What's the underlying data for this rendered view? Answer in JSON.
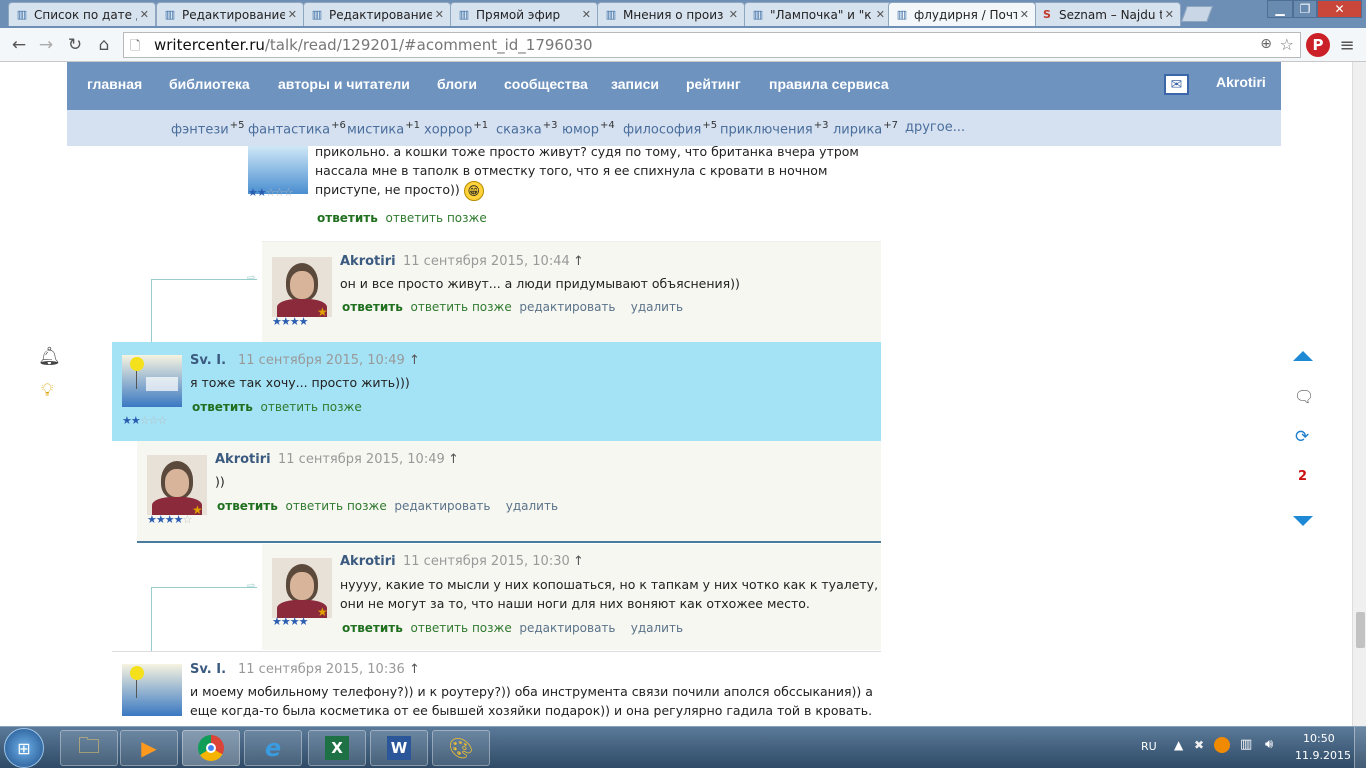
{
  "tabs": [
    {
      "title": "Список по дате д"
    },
    {
      "title": "Редактирование"
    },
    {
      "title": "Редактирование"
    },
    {
      "title": "Прямой эфир"
    },
    {
      "title": "Мнения о произ"
    },
    {
      "title": "\"Лампочка\" и \"к"
    },
    {
      "title": "флудирня / Почт"
    },
    {
      "title": "Seznam – Najdu t"
    }
  ],
  "address": {
    "host": "writercenter.ru",
    "path": "/talk/read/129201/#acomment_id_1796030"
  },
  "nav": {
    "items": [
      "главная",
      "библиотека",
      "авторы и читатели",
      "блоги",
      "сообщества",
      "записи",
      "рейтинг",
      "правила сервиса"
    ],
    "user": "Akrotiri"
  },
  "genres": [
    {
      "label": "фэнтези",
      "count": "+5"
    },
    {
      "label": "фантастика",
      "count": "+6"
    },
    {
      "label": "мистика",
      "count": "+1"
    },
    {
      "label": "хоррор",
      "count": "+1"
    },
    {
      "label": "сказка",
      "count": "+3"
    },
    {
      "label": "юмор",
      "count": "+4"
    },
    {
      "label": "философия",
      "count": "+5"
    },
    {
      "label": "приключения",
      "count": "+3"
    },
    {
      "label": "лирика",
      "count": "+7"
    },
    {
      "label": "другое...",
      "count": ""
    }
  ],
  "actions": {
    "reply": "ответить",
    "later": "ответить позже",
    "edit": "редактировать",
    "del": "удалить"
  },
  "arrow": "↑",
  "comments": [
    {
      "author": "",
      "date": "",
      "text": "прикольно. а кошки тоже просто живут? судя по тому, что британка вчера утром нассала мне в таполк в отместку того, что я ее спихнула с кровати в ночном приступе, не просто))",
      "stars": 2
    },
    {
      "author": "Akrotiri",
      "date": "11 сентября 2015, 10:44",
      "text": "он и все просто живут... а люди придумывают объяснения))",
      "stars": 4
    },
    {
      "author": "Sv. I.",
      "date": "11 сентября 2015, 10:49",
      "text": "я тоже так хочу... просто жить)))",
      "stars": 2
    },
    {
      "author": "Akrotiri",
      "date": "11 сентября 2015, 10:49",
      "text": "))",
      "stars": 4
    },
    {
      "author": "Akrotiri",
      "date": "11 сентября 2015, 10:30",
      "text": "нуууу, какие то мысли у них копошаться, но к тапкам у них чотко как к туалету, они не могут за то, что наши ноги для них воняют как отхожее место.",
      "stars": 4
    },
    {
      "author": "Sv. I.",
      "date": "11 сентября 2015, 10:36",
      "text": "и моему мобильному телефону?)) и к роутеру?)) оба инструмента связи почили аполся обссыкания)) а еще когда-то была косметика от ее бывшей хозяйки подарок)) и она регулярно гадила той в кровать.",
      "stars": 2
    }
  ],
  "sidebar_right": {
    "count": "2"
  },
  "tray": {
    "lang": "RU",
    "time": "10:50",
    "date": "11.9.2015"
  },
  "colors": {
    "highlight": "#a4e3f6",
    "nav": "#6f93bf",
    "genre_bar": "#d5e1f1",
    "reply_green": "#207020"
  }
}
